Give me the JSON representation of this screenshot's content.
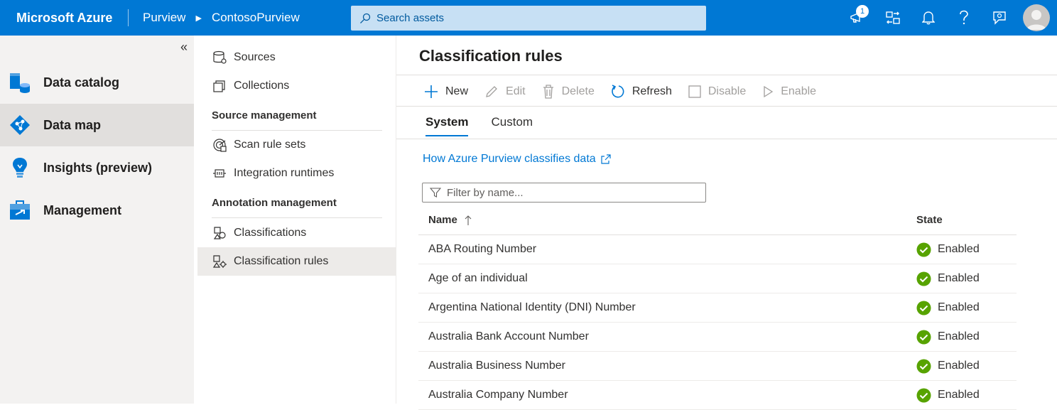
{
  "topbar": {
    "brand": "Microsoft Azure",
    "breadcrumb": [
      "Purview",
      "ContosoPurview"
    ],
    "search_placeholder": "Search assets",
    "notification_count": "1"
  },
  "leftnav": {
    "collapse_glyph": "«",
    "items": [
      {
        "label": "Data catalog",
        "icon": "data-catalog-icon"
      },
      {
        "label": "Data map",
        "icon": "data-map-icon"
      },
      {
        "label": "Insights (preview)",
        "icon": "insights-icon"
      },
      {
        "label": "Management",
        "icon": "management-icon"
      }
    ]
  },
  "subnav": {
    "items": {
      "sources": "Sources",
      "collections": "Collections",
      "scan_rule_sets": "Scan rule sets",
      "integration_runtimes": "Integration runtimes",
      "classifications": "Classifications",
      "classification_rules": "Classification rules"
    },
    "headers": {
      "source_management": "Source management",
      "annotation_management": "Annotation management"
    }
  },
  "main": {
    "title": "Classification rules",
    "toolbar": {
      "new": "New",
      "edit": "Edit",
      "delete": "Delete",
      "refresh": "Refresh",
      "disable": "Disable",
      "enable": "Enable"
    },
    "tabs": [
      "System",
      "Custom"
    ],
    "help_link": "How Azure Purview classifies data",
    "filter_placeholder": "Filter by name...",
    "table": {
      "columns": {
        "name": "Name",
        "state": "State"
      },
      "rows": [
        {
          "name": "ABA Routing Number",
          "state": "Enabled"
        },
        {
          "name": "Age of an individual",
          "state": "Enabled"
        },
        {
          "name": "Argentina National Identity (DNI) Number",
          "state": "Enabled"
        },
        {
          "name": "Australia Bank Account Number",
          "state": "Enabled"
        },
        {
          "name": "Australia Business Number",
          "state": "Enabled"
        },
        {
          "name": "Australia Company Number",
          "state": "Enabled"
        }
      ]
    }
  },
  "colors": {
    "accent": "#0078d4",
    "success": "#57a300"
  }
}
